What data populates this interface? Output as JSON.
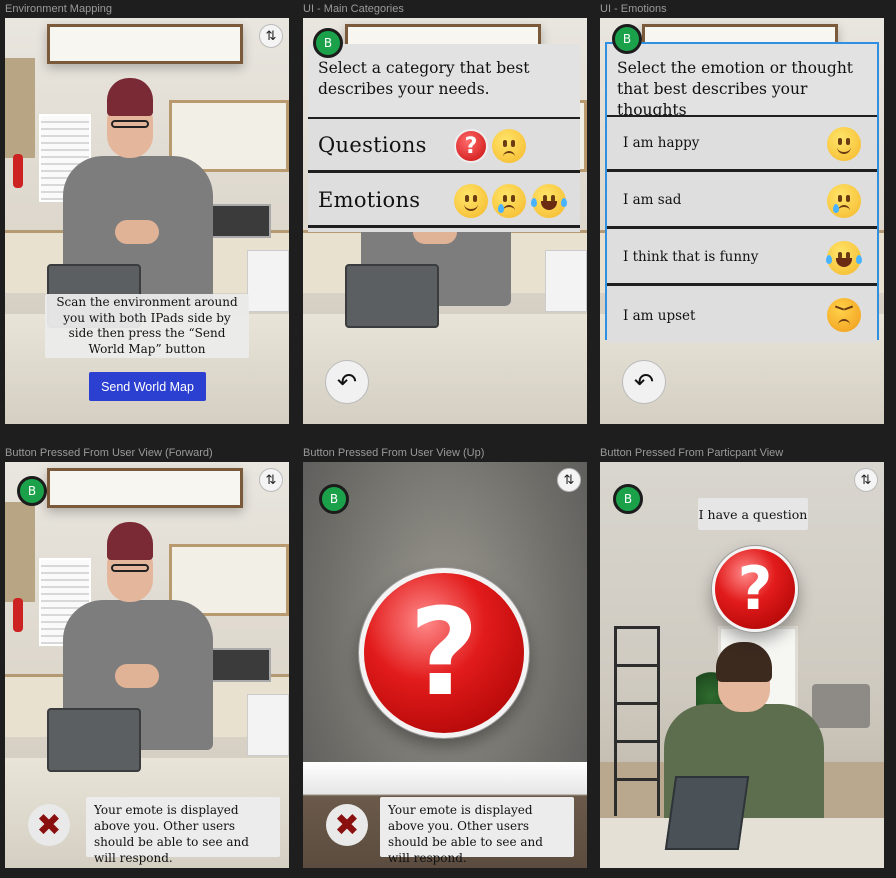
{
  "frames": {
    "env": {
      "label": "Environment Mapping",
      "instruction": "Scan the environment around you with both IPads side by side then press the “Send World Map” button",
      "send_button": "Send World Map"
    },
    "main": {
      "label": "UI - Main Categories",
      "badge": "B",
      "prompt": "Select a category that best describes your needs.",
      "categories": [
        {
          "label": "Questions",
          "icons": [
            "red-question-mark-icon",
            "thinking-face-icon"
          ]
        },
        {
          "label": "Emotions",
          "icons": [
            "smiling-face-icon",
            "crying-face-icon",
            "tears-of-joy-face-icon"
          ]
        }
      ]
    },
    "emotions": {
      "label": "UI - Emotions",
      "badge": "B",
      "prompt": "Select the emotion or thought that best describes your thoughts",
      "items": [
        {
          "label": "I am happy",
          "icon": "smiling-face-icon"
        },
        {
          "label": "I am sad",
          "icon": "crying-face-icon"
        },
        {
          "label": "I think that is funny",
          "icon": "tears-of-joy-face-icon"
        },
        {
          "label": "I am upset",
          "icon": "angry-face-icon"
        }
      ]
    },
    "forward": {
      "label": "Button Pressed From User View (Forward)",
      "badge": "B",
      "feedback": "Your emote is displayed above you. Other users should be able to see and will respond."
    },
    "up": {
      "label": "Button Pressed From User View (Up)",
      "badge": "B",
      "feedback": "Your emote is displayed above you. Other users should be able to see and will respond."
    },
    "participant": {
      "label": "Button Pressed From Particpant View",
      "badge": "B",
      "message": "I have a question"
    }
  },
  "colors": {
    "badge_green": "#1aa14a",
    "send_button_blue": "#2b3fd1",
    "emote_red": "#e21b1b",
    "panel_gray": "#dedede",
    "selection_blue": "#2f8fe0"
  },
  "glyphs": {
    "swap": "⇅",
    "back": "↶",
    "close": "✖",
    "question": "?"
  }
}
